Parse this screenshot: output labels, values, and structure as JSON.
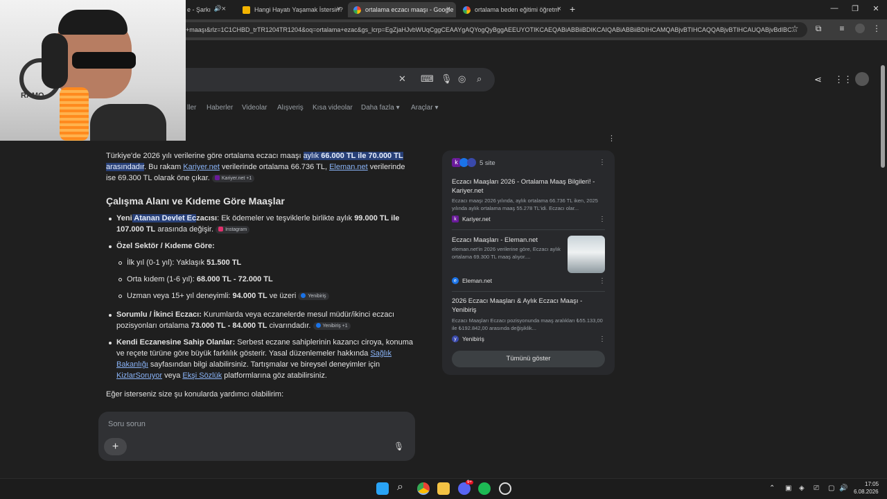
{
  "tabs": [
    {
      "title": "e - Şarkı",
      "active": false,
      "color": "#ffffff"
    },
    {
      "title": "Hangi Hayatı Yaşamak İstersin?",
      "active": false,
      "color": "#f4b400"
    },
    {
      "title": "ortalama eczacı maaşı - Google",
      "active": true,
      "color": "#4285f4"
    },
    {
      "title": "ortalama beden eğitimi öğretm",
      "active": false,
      "color": "#4285f4"
    }
  ],
  "new_tab": "+",
  "address": {
    "url": "+maaşı&rlz=1C1CHBD_trTR1204TR1204&oq=ortalama+ezac&gs_lcrp=EgZjaHJvbWUqCggCEAAYgAQYogQyBggAEEUYOTIKCAEQABiABBiiBDIKCAIQABiABBiiBDIHCAMQABjvBTIHCAQQABjvBTIHCAUQABjvBdIBC..."
  },
  "nav_tabs": [
    "ller",
    "Haberler",
    "Videolar",
    "Alışveriş",
    "Kısa videolar",
    "Daha fazla",
    "Araçlar"
  ],
  "answer": {
    "p1_a": "Türkiye'de 2026 yılı verilerine göre ortalama eczacı maaşı ",
    "p1_hl1": "aylık ",
    "p1_hl_bold": "66.000 TL ile 70.000 TL",
    "p1_hl2": "arasındadır",
    "p1_b": ". Bu rakam ",
    "p1_link1": "Kariyer.net",
    "p1_c": " verilerinde ortalama 66.736 TL, ",
    "p1_link2": "Eleman.net",
    "p1_d": " verilerinde",
    "p1_e": "ise 69.300 TL olarak öne çıkar.",
    "p1_chip": "Kariyer.net +1",
    "heading": "Çalışma Alanı ve Kıdeme Göre Maaşlar",
    "b1_bold_a": "Yeni",
    "b1_bold_hl": " Atanan Devlet Ec",
    "b1_bold_b": "zacısı",
    "b1_text": ": Ek ödemeler ve teşviklerle birlikte aylık ",
    "b1_val": "99.000 TL ile",
    "b1_val2": "107.000 TL",
    "b1_text2": " arasında değişir.",
    "b1_chip": "Instagram",
    "b2_bold": "Özel Sektör / Kıdeme Göre:",
    "s1_text": "İlk yıl (0-1 yıl): Yaklaşık ",
    "s1_val": "51.500 TL",
    "s2_text": "Orta kıdem (1-6 yıl): ",
    "s2_val": "68.000 TL - 72.000 TL",
    "s3_text": "Uzman veya 15+ yıl deneyimli: ",
    "s3_val": "94.000 TL",
    "s3_text2": " ve üzeri",
    "s3_chip": "Yenibiriş",
    "b3_bold": "Sorumlu / İkinci Eczacı:",
    "b3_text": " Kurumlarda veya eczanelerde mesul müdür/ikinci eczacı",
    "b3_text2": "pozisyonları ortalama ",
    "b3_val": "73.000 TL - 84.000 TL",
    "b3_text3": " civarındadır.",
    "b3_chip": "Yenibiriş +1",
    "b4_bold": "Kendi Eczanesine Sahip Olanlar:",
    "b4_text": " Serbest eczane sahiplerinin kazancı ciroya, konuma",
    "b4_text2": "ve reçete türüne göre büyük farklılık gösterir. Yasal düzenlemeler hakkında ",
    "b4_link1": "Sağlık",
    "b4_link1b": "Bakanlığı",
    "b4_text3": " sayfasından bilgi alabilirsiniz. Tartışmalar ve bireysel deneyimler için",
    "b4_link2": "KizlarSoruyor",
    "b4_text4": " veya ",
    "b4_link3": "Ekşi Sözlük",
    "b4_text5": " platformlarına göz atabilirsiniz.",
    "closing": "Eğer isterseniz size şu konularda yardımcı olabilirim:"
  },
  "sources": {
    "count_label": "5 site",
    "items": [
      {
        "title": "Eczacı Maaşları 2026 - Ortalama Maaş Bilgileri! - Kariyer.net",
        "desc": "Eczacı maaşı 2026 yılında, aylık ortalama 66.736 TL iken, 2025 yılında aylık ortalama maaş 55.278 TL'idi. Eczacı olar...",
        "site": "Kariyer.net",
        "color": "#6a1b9a",
        "letter": "k"
      },
      {
        "title": "Eczacı Maaşları - Eleman.net",
        "desc": "eleman.net'in 2026 verilerine göre, Eczacı aylık ortalama 69.300 TL maaş alıyor....",
        "site": "Eleman.net",
        "color": "#1a73e8",
        "letter": "e"
      },
      {
        "title": "2026 Eczacı Maaşları & Aylık Eczacı Maaşı - Yenibiriş",
        "desc": "Eczacı Maaşları Eczacı pozisyonunda maaş aralıkları ₺55.133,00 ile ₺192.842,00 arasında değişiklik...",
        "site": "Yenibiriş",
        "color": "#1a73e8",
        "letter": "y"
      }
    ],
    "show_all": "Tümünü göster"
  },
  "ask": {
    "placeholder": "Soru sorun",
    "plus": "+"
  },
  "webcam_text": "RAMO",
  "clock": {
    "time": "17:05",
    "date": "6.08.2026"
  },
  "badges": {
    "discord": "9+"
  }
}
